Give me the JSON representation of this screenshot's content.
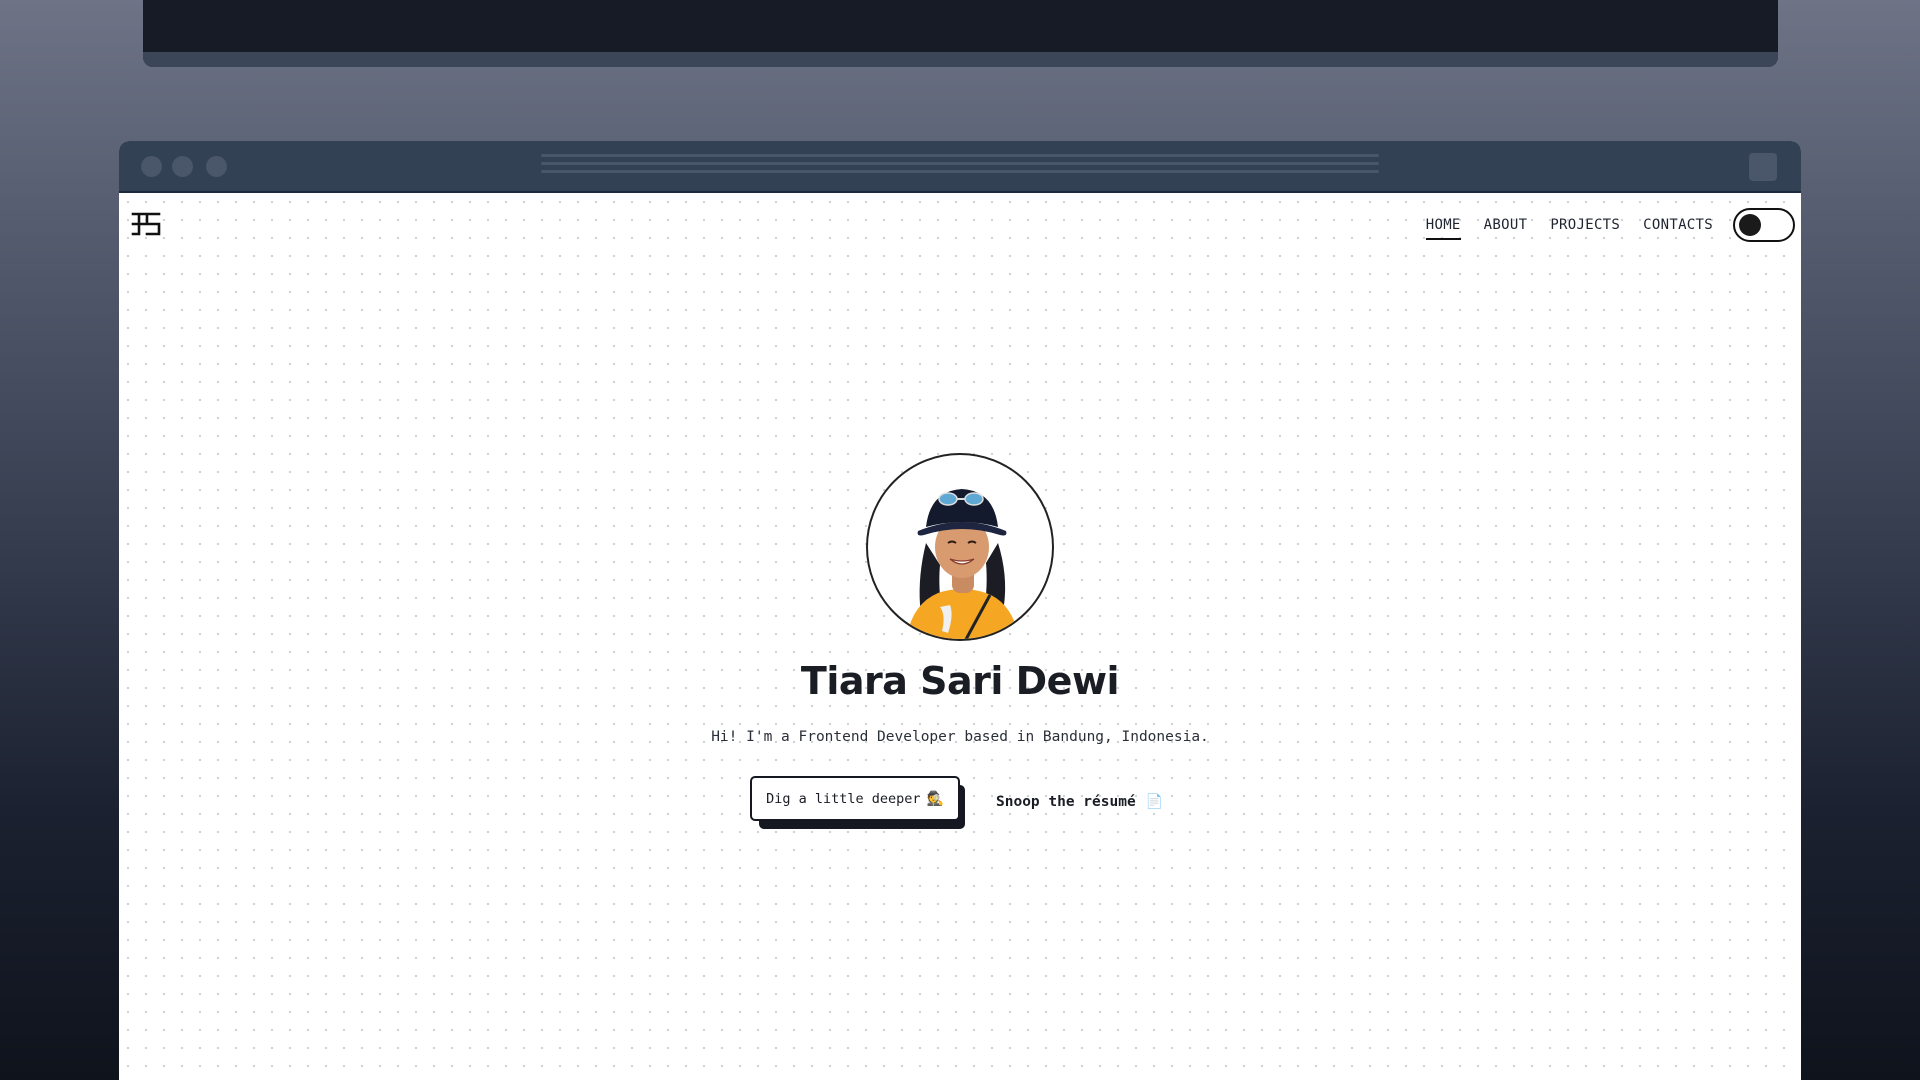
{
  "nav": {
    "items": [
      {
        "label": "HOME",
        "active": true
      },
      {
        "label": "ABOUT",
        "active": false
      },
      {
        "label": "PROJECTS",
        "active": false
      },
      {
        "label": "CONTACTS",
        "active": false
      }
    ],
    "theme_toggle": {
      "state": "off"
    }
  },
  "hero": {
    "name": "Tiara Sari Dewi",
    "tagline": "Hi! I'm a Frontend Developer based in Bandung, Indonesia.",
    "primary_button": {
      "label": "Dig a little deeper",
      "emoji": "🕵️"
    },
    "secondary_button": {
      "label": "Snoop the résumé",
      "emoji": "📄"
    }
  },
  "colors": {
    "titlebar": "#334155",
    "ink": "#151821",
    "page_bg": "#ffffff",
    "dot_grid": "#cfd3d8"
  }
}
